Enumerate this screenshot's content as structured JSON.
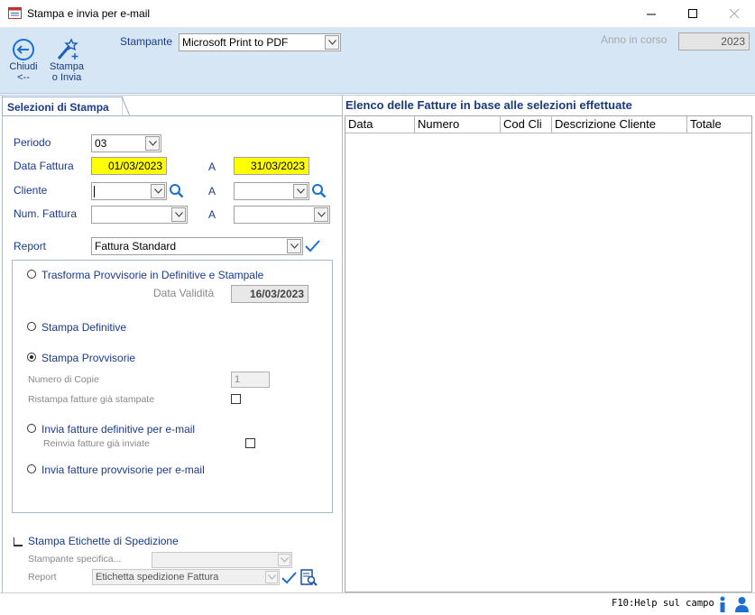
{
  "window": {
    "title": "Stampa e invia per e-mail"
  },
  "toolbar": {
    "close_label_1": "Chiudi",
    "close_label_2": "<--",
    "print_label_1": "Stampa",
    "print_label_2": "o Invia",
    "printer_label": "Stampante",
    "printer_value": "Microsoft Print to PDF",
    "year_label": "Anno in corso",
    "year_value": "2023"
  },
  "left_tab": {
    "label": "Selezioni di Stampa"
  },
  "filters": {
    "period_label": "Periodo",
    "period_value": "03",
    "date_label": "Data Fattura",
    "date_from": "01/03/2023",
    "date_to": "31/03/2023",
    "to_label": "A",
    "customer_label": "Cliente",
    "customer_from": "",
    "customer_to": "",
    "invoice_label": "Num. Fattura",
    "invoice_from": "",
    "invoice_to": "",
    "report_label": "Report",
    "report_value": "Fattura Standard"
  },
  "options": {
    "opt1_label": "Trasforma Provvisorie in Definitive e Stampale",
    "validity_label": "Data Validità",
    "validity_value": "16/03/2023",
    "opt2_label": "Stampa Definitive",
    "opt3_label": "Stampa Provvisorie",
    "copies_label": "Numero di Copie",
    "copies_value": "1",
    "reprint_label": "Ristampa fatture già stampate",
    "opt4_label": "Invia fatture definitive per e-mail",
    "resend_label": "Reinvia fatture già inviate",
    "opt5_label": "Invia fatture provvisorie per e-mail",
    "selected": "opt3"
  },
  "labels": {
    "shipping_label": "Stampa Etichette di Spedizione",
    "specific_printer_label": "Stampante specifica...",
    "specific_printer_value": "",
    "report_label": "Report",
    "report_value": "Etichetta spedizione Fattura"
  },
  "invoice_list": {
    "title": "Elenco delle Fatture in base alle selezioni effettuate",
    "columns": [
      "Data",
      "Numero",
      "Cod Cli",
      "Descrizione Cliente",
      "Totale"
    ]
  },
  "status": {
    "help_text": "F10:Help sul campo"
  },
  "colors": {
    "accent": "#1a6fd0",
    "toolbar_bg": "#d6e6f5",
    "highlight": "#ffff00"
  }
}
